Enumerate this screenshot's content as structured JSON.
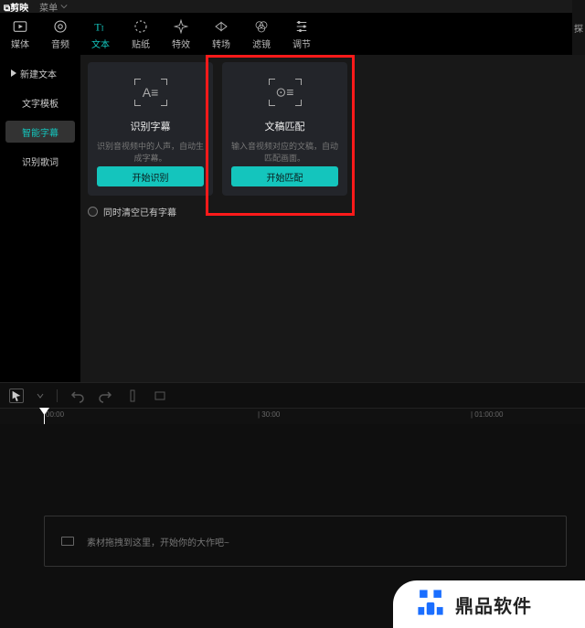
{
  "titlebar": {
    "appname": "剪映",
    "menu": "菜单"
  },
  "tabs": [
    {
      "label": "媒体"
    },
    {
      "label": "音频"
    },
    {
      "label": "文本"
    },
    {
      "label": "贴纸"
    },
    {
      "label": "特效"
    },
    {
      "label": "转场"
    },
    {
      "label": "滤镜"
    },
    {
      "label": "调节"
    }
  ],
  "sidebar": {
    "items": [
      {
        "label": "新建文本"
      },
      {
        "label": "文字模板"
      },
      {
        "label": "智能字幕"
      },
      {
        "label": "识别歌词"
      }
    ]
  },
  "cards": {
    "recognize": {
      "title": "识别字幕",
      "desc": "识别音视频中的人声，自动生成字幕。",
      "button": "开始识别"
    },
    "match": {
      "title": "文稿匹配",
      "desc": "输入音视频对应的文稿，自动匹配画面。",
      "button": "开始匹配"
    }
  },
  "checkbox": {
    "label": "同时清空已有字幕"
  },
  "right_strip": "探",
  "ruler": {
    "t0": "00:00",
    "t1": "| 30:00",
    "t2": "| 01:00:00"
  },
  "timeline": {
    "hint": "素材拖拽到这里，开始你的大作吧~"
  },
  "watermark": {
    "text": "鼎品软件"
  }
}
